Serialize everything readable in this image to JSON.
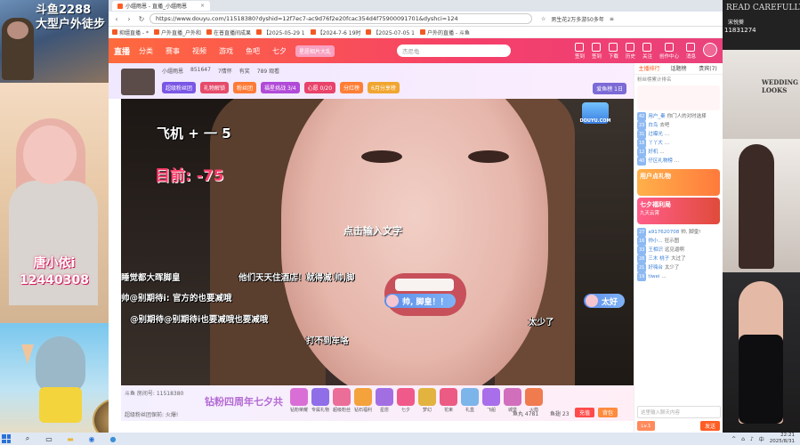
{
  "left_collage": {
    "title_line1": "斗鱼2288",
    "title_line2": "大型户外徒步",
    "streamer_name": "唐小依i",
    "streamer_id": "12440308"
  },
  "browser": {
    "tabs": [
      {
        "label": "小缰雨恩 - 直播_小缰雨恩"
      }
    ],
    "url": "https://www.douyu.com/11518380?dyshid=12f7ec7-ac9d76f2e20fcac354d4f75900091701&dyshci=124",
    "addr_right": "男生花2万多游50多年",
    "bookmarks": [
      "抑缰直播 - *",
      "户外直播_户外和",
      "在普直播间成果",
      "【2025-05-29 1",
      "【2024-7-6 19时",
      "【2025-07-05 1",
      "户外的直播 - 斗鱼"
    ]
  },
  "douyu_header": {
    "logo": "直播",
    "nav": [
      "分类",
      "赛事",
      "视频",
      "游戏",
      "鱼吧",
      "七夕"
    ],
    "hot_badge": "星愿相片大乱",
    "search_placeholder": "杰尼龟",
    "icons": [
      "签到",
      "签到",
      "下载",
      "历史",
      "关注",
      "创作中心",
      "消息"
    ]
  },
  "room": {
    "line1": [
      "小缰雨恩",
      "851647",
      "7情怀",
      "有奖",
      "789 观看"
    ],
    "pills": [
      {
        "label": "超级粉丝团",
        "color": "#7a57e6"
      },
      {
        "label": "礼物解锁",
        "color": "#e64a6a"
      },
      {
        "label": "粉丝团",
        "color": "#ff7b35"
      },
      {
        "label": "福星挑战 3/4",
        "color": "#b14ad8"
      },
      {
        "label": "心愿 0/20",
        "color": "#e9436a"
      },
      {
        "label": "分红榜",
        "color": "#ff7e35"
      },
      {
        "label": "6月分享榜",
        "color": "#f1a630"
      }
    ],
    "right_badge": "爱鱼榜 1日"
  },
  "video": {
    "overlay_line1": "飞机 + 一 5",
    "overlay_line2": "目前: -75",
    "center_hint": "点击输入文字",
    "danmaku": [
      "睡觉都大晖脚皇",
      "他们天天住酒店！就得减  帅,脚",
      "帅@别期待i: 官方的也要减哦",
      "@别期待@别期待i也要减哦也要减哦",
      "打不到车咯",
      "太少了"
    ],
    "bubble1": "帅, 脚皇！！",
    "bubble2": "太好",
    "badge": "DOUYU.COM"
  },
  "giftbar": {
    "room_no": "斗鱼 房间号: 11518380",
    "hint": "超级粉丝团保前: 火爆!",
    "center": "钻粉四周年七夕共",
    "gifts": [
      {
        "label": "钻粉荣耀",
        "color": "#d96fd6"
      },
      {
        "label": "专属礼物",
        "color": "#8f6ee8"
      },
      {
        "label": "超级粉丝",
        "color": "#eb6e98"
      },
      {
        "label": "钻石福利",
        "color": "#f3a23c"
      },
      {
        "label": "星愿",
        "color": "#a26fe3"
      },
      {
        "label": "七夕",
        "color": "#f05a8a"
      },
      {
        "label": "梦幻",
        "color": "#e3b33f"
      },
      {
        "label": "花束",
        "color": "#ec5b84"
      },
      {
        "label": "礼盒",
        "color": "#7cb5ea"
      },
      {
        "label": "飞船",
        "color": "#a96ee9"
      },
      {
        "label": "城堡",
        "color": "#d16fbd"
      },
      {
        "label": "火箭",
        "color": "#f07b4f"
      }
    ],
    "fish": "鱼丸 4781",
    "fish2": "鱼翅 23",
    "recharge": "充值",
    "bag": "背包"
  },
  "right_panel": {
    "tabs": [
      "主播排行",
      "话题榜",
      "贵宾(7)"
    ],
    "header": "粉丝榜累计排名",
    "chat": [
      {
        "lvl": "42",
        "name": "用户_秦",
        "text": "你门人的对时选择"
      },
      {
        "lvl": "23",
        "name": "白鸟",
        "text": "去吧"
      },
      {
        "lvl": "31",
        "name": "过曝光",
        "text": "..."
      },
      {
        "lvl": "18",
        "name": "丫丫大",
        "text": "..."
      },
      {
        "lvl": "12",
        "name": "好机",
        "text": "..."
      },
      {
        "lvl": "40",
        "name": "仔区礼物榜",
        "text": "..."
      }
    ],
    "promo1": "用户点礼物",
    "promo2": "七夕福利局",
    "promo2_sub": "九天云霄",
    "chat2": [
      {
        "lvl": "27",
        "name": "a917620708",
        "text": "帅, 脚皇!"
      },
      {
        "lvl": "16",
        "name": "帅小...",
        "text": "狂示图"
      },
      {
        "lvl": "33",
        "name": "王相识",
        "text": "远见逼啊"
      },
      {
        "lvl": "28",
        "name": "三木 桃子",
        "text": "大过了"
      },
      {
        "lvl": "21",
        "name": "好嗨台",
        "text": "太少了"
      },
      {
        "lvl": "19",
        "name": "tiwei",
        "text": "..."
      }
    ],
    "input_placeholder": "这里输入聊天内容",
    "level": "Lv.1",
    "send": "发送"
  },
  "right_collage": {
    "banner_text": "READ CAREFULLY",
    "name": "宋悦葵",
    "id": "11831274",
    "wedding": "WEDDING LOOKS"
  },
  "taskbar": {
    "time": "22:21",
    "date": "2025/8/31",
    "ime": "中"
  }
}
